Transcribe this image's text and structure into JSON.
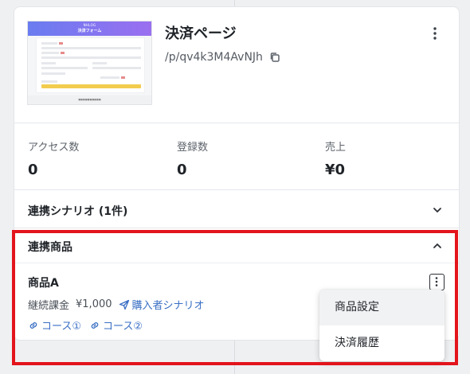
{
  "page": {
    "title": "決済ページ",
    "url": "/p/qv4k3M4AvNJh"
  },
  "thumbnail": {
    "brand": "NHLOG",
    "heading": "決済フォーム"
  },
  "stats": [
    {
      "label": "アクセス数",
      "value": "0"
    },
    {
      "label": "登録数",
      "value": "0"
    },
    {
      "label": "売上",
      "value": "¥0"
    }
  ],
  "sections": {
    "scenario_title": "連携シナリオ (1件)",
    "products_title": "連携商品"
  },
  "product": {
    "name": "商品A",
    "billing": "継続課金",
    "price": "¥1,000",
    "scenario_link": "購入者シナリオ",
    "courses": [
      "コース①",
      "コース②"
    ]
  },
  "menu": {
    "items": [
      "商品設定",
      "決済履歴"
    ]
  },
  "colors": {
    "highlight": "#e3141c",
    "link": "#3a6fc4"
  }
}
